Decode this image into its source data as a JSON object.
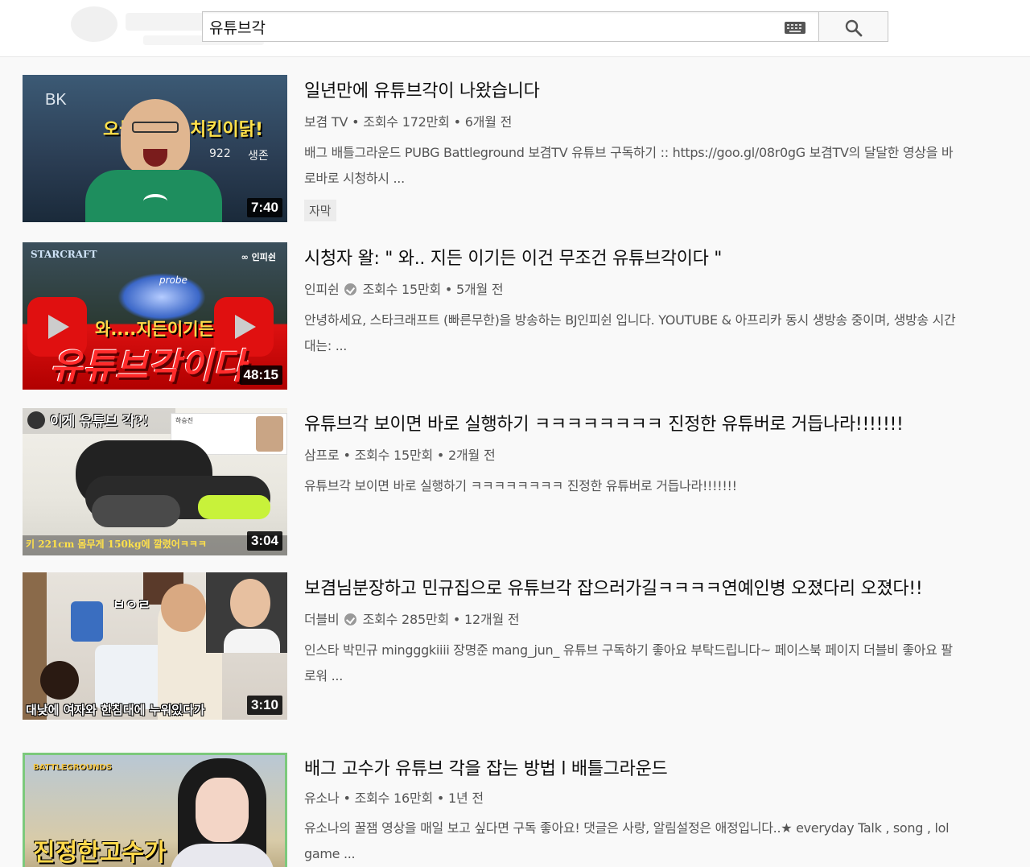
{
  "search": {
    "query": "유튜브각"
  },
  "results": [
    {
      "title": "일년만에 유튜브각이 나왔습니다",
      "channel": "보겸 TV",
      "views": "조회수 172만회",
      "age": "6개월 전",
      "desc": "배그 배틀그라운드 PUBG Battleground 보겸TV 유튜브 구독하기 :: https://goo.gl/08r0gG 보겸TV의 달달한 영상을 바로바로 시청하시 ...",
      "duration": "7:40",
      "badge": "자막",
      "thumb_text": [
        "BK",
        "오늘",
        "치킨이닭!",
        "922",
        "생존"
      ]
    },
    {
      "title": "시청자 왈: \" 와.. 지든 이기든 이건 무조건 유튜브각이다 \"",
      "channel": "인피쉰",
      "views": "조회수 15만회",
      "age": "5개월 전",
      "desc": "안녕하세요, 스타크래프트 (빠른무한)을 방송하는 BJ인피쉰 입니다. YOUTUBE & 아프리카 동시 생방송 중이며, 생방송 시간대는: ...",
      "duration": "48:15",
      "thumb_text": [
        "STARCRAFT",
        "∞ 인피쉰",
        "probe",
        "와....지든이기든",
        "유튜브각이다"
      ]
    },
    {
      "title": "유튜브각 보이면 바로 실행하기 ㅋㅋㅋㅋㅋㅋㅋㅋ 진정한 유튜버로 거듭나라!!!!!!!",
      "channel": "삼프로",
      "views": "조회수 15만회",
      "age": "2개월 전",
      "desc": "유튜브각 보이면 바로 실행하기 ㅋㅋㅋㅋㅋㅋㅋㅋ 진정한 유튜버로 거듭나라!!!!!!!",
      "duration": "3:04",
      "thumb_text": [
        "이게 유튜브 각?!",
        "하승진",
        "키 221cm 몸무게 150kg에 깔렸어ㅋㅋㅋ"
      ]
    },
    {
      "title": "보겸님분장하고 민규집으로 유튜브각 잡으러가길ㅋㅋㅋㅋ연예인병 오졌다리 오졌다!!",
      "channel": "더블비",
      "views": "조회수 285만회",
      "age": "12개월 전",
      "desc": "인스타 박민규 mingggkiiii 장명준 mang_jun_ 유튜브 구독하기 좋아요 부탁드립니다~ 페이스북 페이지 더블비 좋아요 팔로워 ...",
      "duration": "3:10",
      "thumb_text": [
        "ㅂㅇㄹ",
        "대낮에 여자와 한침대에 누워있다가"
      ]
    },
    {
      "title": "배그 고수가 유튜브 각을 잡는 방법 l 배틀그라운드",
      "channel": "유소나",
      "views": "조회수 16만회",
      "age": "1년 전",
      "desc": "유소나의 꿀잼 영상을 매일 보고 싶다면 구독 좋아요! 댓글은 사랑, 알림설정은 애정입니다..★ everyday Talk , song , lol game ...",
      "thumb_text": [
        "BATTLEGROUNDS",
        "진정한고수가"
      ]
    }
  ],
  "colors": {
    "text": "#0d0d0d",
    "meta": "#555555",
    "background": "#f9f9f9"
  }
}
